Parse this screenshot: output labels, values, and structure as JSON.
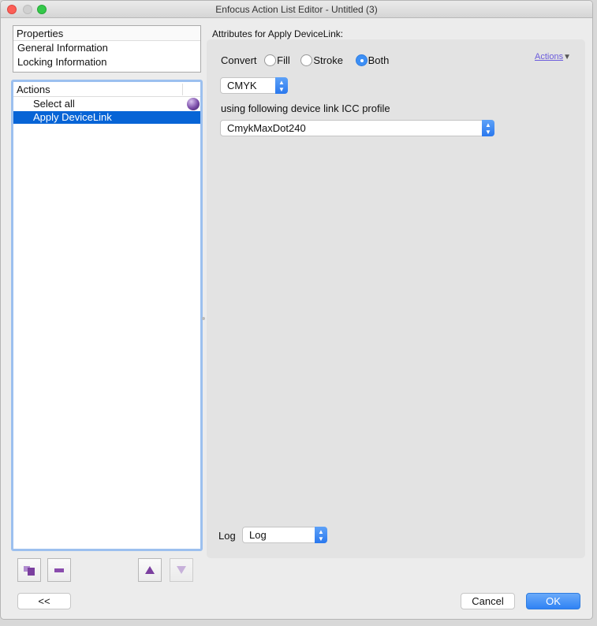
{
  "window": {
    "title": "Enfocus Action List Editor - Untitled (3)"
  },
  "properties": {
    "header": "Properties",
    "items": [
      "General Information",
      "Locking Information"
    ]
  },
  "actions": {
    "header": "Actions",
    "items": [
      "Select all",
      "Apply DeviceLink"
    ],
    "selected": 1
  },
  "attributes": {
    "title": "Attributes for Apply DeviceLink:",
    "convert_label": "Convert",
    "options": [
      "Fill",
      "Stroke",
      "Both"
    ],
    "selected_option": "Both",
    "actions_link": "Actions",
    "colorspace": "CMYK",
    "profile_label": "using following device link ICC profile",
    "profile": "CmykMaxDot240",
    "log_label": "Log",
    "log_value": "Log"
  },
  "buttons": {
    "collapse": "<<",
    "cancel": "Cancel",
    "ok": "OK"
  },
  "colors": {
    "accent": "#0764d6",
    "ok": "#3d8ff5"
  }
}
